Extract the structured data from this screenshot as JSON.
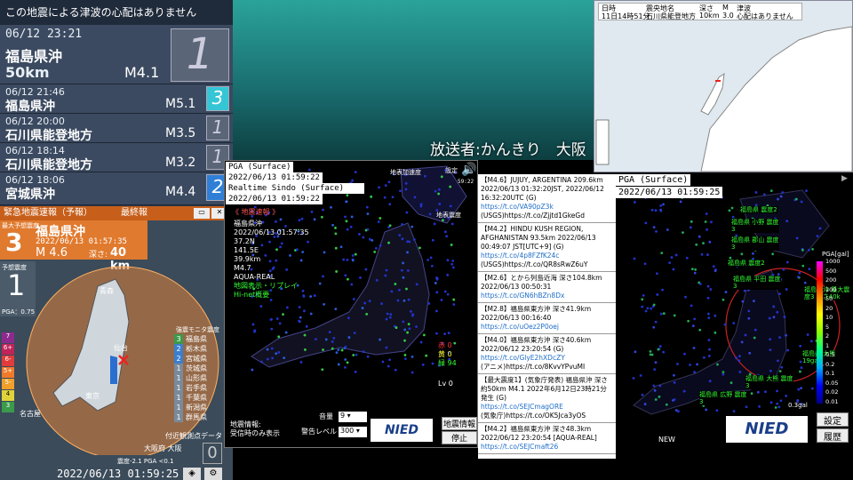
{
  "quake_list": {
    "header": "この地震による津波の心配はありません",
    "latest": {
      "datetime": "06/12 23:21",
      "place": "福島県沖",
      "depth": "50km",
      "mag": "M4.1",
      "intensity": "1"
    },
    "rows": [
      {
        "datetime": "06/12 21:46",
        "place": "福島県沖",
        "mag": "M5.1",
        "intensity": "3"
      },
      {
        "datetime": "06/12 20:00",
        "place": "石川県能登地方",
        "mag": "M3.5",
        "intensity": "1"
      },
      {
        "datetime": "06/12 18:14",
        "place": "石川県能登地方",
        "mag": "M3.2",
        "intensity": "1"
      },
      {
        "datetime": "06/12 18:06",
        "place": "宮城県沖",
        "mag": "M4.4",
        "intensity": "2"
      }
    ]
  },
  "broadcaster": "放送者:かんきり　大阪",
  "top_map": {
    "headers": [
      "日時",
      "震央地名",
      "深さ",
      "M",
      "津波"
    ],
    "values": [
      "11日14時51分",
      "石川県能登地方",
      "10km",
      "3.0",
      "心配はありません"
    ]
  },
  "eew": {
    "title": "緊急地震速報（予報）",
    "final": "最終報",
    "max_label": "最大予想震度",
    "max_int": "3",
    "place": "福島県沖",
    "time": "2022/06/13 01:57:35",
    "mag": "M 4.6",
    "depth_label": "深さ:",
    "depth": "40 km",
    "local_label": "予想震度",
    "local_int": "1",
    "pga": "PGA：0.75",
    "monitor_title": "強震モニタ震度",
    "monitor": [
      {
        "int": "3",
        "pref": "福島県"
      },
      {
        "int": "2",
        "pref": "栃木県"
      },
      {
        "int": "2",
        "pref": "宮城県"
      },
      {
        "int": "1",
        "pref": "茨城県"
      },
      {
        "int": "1",
        "pref": "山形県"
      },
      {
        "int": "1",
        "pref": "岩手県"
      },
      {
        "int": "1",
        "pref": "千葉県"
      },
      {
        "int": "1",
        "pref": "新潟県"
      },
      {
        "int": "1",
        "pref": "群馬県"
      }
    ],
    "map_labels": {
      "aomori": "青森",
      "sendai": "仙台",
      "tokyo": "東京",
      "nagoya": "名古屋"
    },
    "scale": [
      "7",
      "6+",
      "6-",
      "5+",
      "5-",
      "4",
      "3"
    ],
    "nearby_title": "付近観測点データ",
    "nearby_place": "大阪府 大阪",
    "nearby_int": "0",
    "nearby_meta": "震度-2.1  PGA <0.1",
    "clock": "2022/06/13 01:59:25"
  },
  "center": {
    "pga_label": "PGA (Surface)",
    "pga_time": "2022/06/13 01:59:22",
    "sindo_label": "Realtime Sindo (Surface)",
    "sindo_time": "2022/06/13 01:59:22",
    "quick": "《 地震速報 》",
    "info": [
      "福島県沖",
      "2022/06/13 01:57:35",
      "37.2N",
      "141.5E",
      "39.9km",
      "M4.7",
      "AQUA-REAL"
    ],
    "links": [
      "地図表示・リプレイ",
      "Hi-net概要"
    ],
    "surface_accel": "地表加速度",
    "surface_int": "地表震度",
    "setting": "設定",
    "clock": "59:22",
    "red": "赤 0",
    "yellow": "黄 0",
    "green": "緑 94",
    "lv": "Lv 0",
    "volume_label": "音量",
    "volume": "9",
    "alert_label": "警告レベル",
    "alert": "300",
    "note1": "地震情報:",
    "note2": "受信時のみ表示",
    "info_btn": "地震情報",
    "stop_btn": "停止",
    "logo": "NIED"
  },
  "news": [
    {
      "title": "【M4.6】JUJUY, ARGENTINA 209.6km 2022/06/13 01:32:20JST, 2022/06/12 16:32:20UTC (G)",
      "link": "https://t.co/VA90pZ3k",
      "tail": "(USGS)https://t.co/Zjjtd1GkeGd"
    },
    {
      "title": "【M4.2】HINDU KUSH REGION, AFGHANISTAN 93.5km 2022/06/13 00:49:07 JST[UTC+9] (G)",
      "link": "https://t.co/4p8FZfK24c",
      "tail": "(USGS)https://t.co/QR8sRwZ6uY"
    },
    {
      "title": "【M2.6】とから列島近海 深さ104.8km 2022/06/13 00:50:31",
      "link": "https://t.co/GN6hBZn8Dx",
      "tail": ""
    },
    {
      "title": "【M2.8】福島県東方沖 深さ41.9km 2022/06/13 00:16:40",
      "link": "https://t.co/uOez2P0oej",
      "tail": ""
    },
    {
      "title": "【M4.0】福島県東方沖 深さ40.6km 2022/06/12 23:20:54 (G)",
      "link": "https://t.co/GlyE2hXDcZY",
      "tail": "(アニメ)https://t.co/8KvvYPvuMI"
    },
    {
      "title": "【最大震度1】(気象庁発表) 福島県沖 深さ約50km M4.1 2022年6月12日23時21分発生 (G)",
      "link": "https://t.co/SEJCmagORE",
      "tail": "(気象庁)https://t.co/OK5Jca3yOS"
    },
    {
      "title": "【M4.2】福島県東方沖 深さ48.3km 2022/06/12 23:20:54 [AQUA-REAL]",
      "link": "https://t.co/SEJCmaft26",
      "tail": ""
    }
  ],
  "right": {
    "pga_label": "PGA (Surface)",
    "pga_time": "2022/06/13 01:59:25",
    "legend_title": "PGA[gal]",
    "legend": [
      "1000",
      "500",
      "200",
      "100",
      "50",
      "20",
      "10",
      "5",
      "2",
      "1",
      "0.5",
      "0.2",
      "0.1",
      "0.05",
      "0.02",
      "0.01"
    ],
    "callouts": [
      {
        "text": "福島県 震度2"
      },
      {
        "text": "福島県 小野 震度3"
      },
      {
        "text": "福島県 郡山 震度3"
      },
      {
        "text": "福島県 震度2"
      },
      {
        "text": "福島県 平田 震度3"
      },
      {
        "text": "福島県沖 最大震度3 深さ40k"
      },
      {
        "text": "福島県 大熊 19gal"
      },
      {
        "text": "福島県 大熊 震度3"
      },
      {
        "text": "福島県 広野 震度3"
      }
    ],
    "gal_value": "0.3gal",
    "new_label": "NEW",
    "setting_btn": "設定",
    "history_btn": "履歴",
    "logo": "NIED"
  },
  "colors": {
    "orange": "#e07a2e",
    "panel": "#3b4a60",
    "green_text": "#33ff33"
  }
}
